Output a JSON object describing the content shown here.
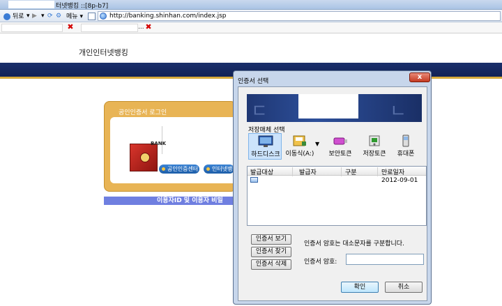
{
  "browser": {
    "title": "터넷뱅킹 ::[8p-b7]",
    "back_label": "뒤로",
    "menu_label": "메뉴",
    "url": "http://banking.shinhan.com/index.jsp",
    "tab_trunc": "..."
  },
  "page": {
    "site_title": "개인인터넷뱅킹",
    "login_title": "공인인증서 로그인",
    "bank_label": "BANK",
    "cert_center_label": "공인인증센터",
    "internet_label": "인터넷뱅킹",
    "notice_text": "이용자ID 및 이용자 비밀"
  },
  "dialog": {
    "title": "인증서 선택",
    "close_label": "x",
    "storage_label": "저장매체 선택",
    "media": [
      {
        "label": "하드디스크",
        "icon": "monitor-icon"
      },
      {
        "label": "이동식(A:)",
        "icon": "removable-disk-icon"
      },
      {
        "label": "보안토큰",
        "icon": "security-token-icon"
      },
      {
        "label": "저장토큰",
        "icon": "storage-token-icon"
      },
      {
        "label": "휴대폰",
        "icon": "phone-icon"
      }
    ],
    "dropdown_arrow": "▼",
    "columns": [
      "발급대상",
      "발급자",
      "구분",
      "만료일자"
    ],
    "rows": [
      {
        "subject": "",
        "issuer": "",
        "type": "",
        "expiry": "2012-09-01"
      }
    ],
    "view_button": "인증서 보기",
    "find_button": "인증서 찾기",
    "delete_button": "인증서 삭제",
    "hint": "인증서 암호는 대소문자를 구분합니다.",
    "password_label": "인증서 암호:",
    "password_value": "",
    "ok_button": "확인",
    "cancel_button": "취소"
  },
  "colors": {
    "band": "#1a2f6b",
    "login_box": "#e8b455",
    "dialog_frame": "#c7d6eb",
    "close_button": "#c43a22"
  }
}
